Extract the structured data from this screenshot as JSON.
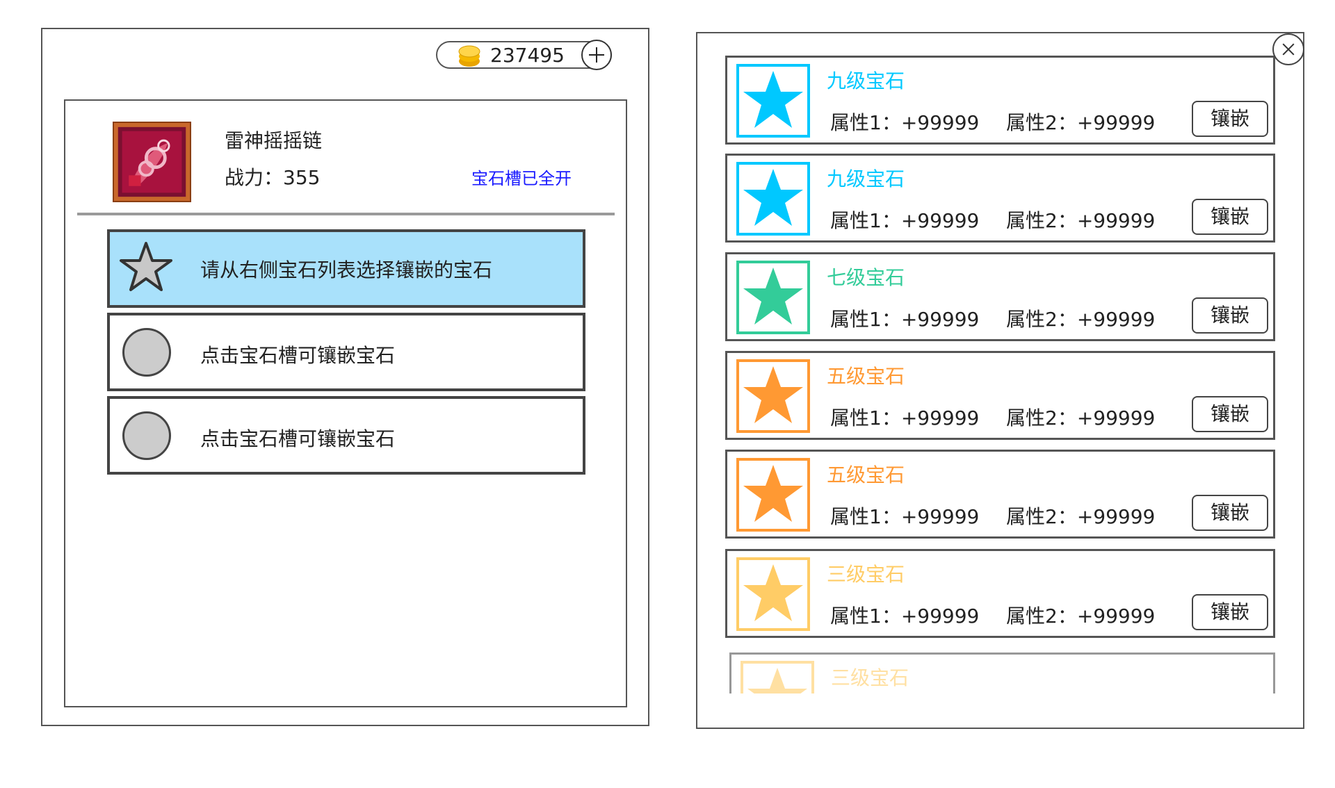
{
  "currency": {
    "amount": "237495",
    "icon": "coin-icon",
    "add_icon": "plus-icon"
  },
  "item": {
    "name": "雷神摇摇链",
    "power_label": "战力：355",
    "slots_status": "宝石槽已全开"
  },
  "slots": [
    {
      "state": "selected",
      "icon": "star-icon",
      "text": "请从右侧宝石列表选择镶嵌的宝石"
    },
    {
      "state": "empty",
      "icon": "empty-slot-circle",
      "text": "点击宝石槽可镶嵌宝石"
    },
    {
      "state": "empty",
      "icon": "empty-slot-circle",
      "text": "点击宝石槽可镶嵌宝石"
    }
  ],
  "gem_list": {
    "close_icon": "close-icon",
    "items": [
      {
        "name": "九级宝石",
        "color": "#00c8ff",
        "attr1": "属性1：+99999",
        "attr2": "属性2：+99999",
        "button": "镶嵌"
      },
      {
        "name": "九级宝石",
        "color": "#00c8ff",
        "attr1": "属性1：+99999",
        "attr2": "属性2：+99999",
        "button": "镶嵌"
      },
      {
        "name": "七级宝石",
        "color": "#33cc99",
        "attr1": "属性1：+99999",
        "attr2": "属性2：+99999",
        "button": "镶嵌"
      },
      {
        "name": "五级宝石",
        "color": "#ff9933",
        "attr1": "属性1：+99999",
        "attr2": "属性2：+99999",
        "button": "镶嵌"
      },
      {
        "name": "五级宝石",
        "color": "#ff9933",
        "attr1": "属性1：+99999",
        "attr2": "属性2：+99999",
        "button": "镶嵌"
      },
      {
        "name": "三级宝石",
        "color": "#ffcc66",
        "attr1": "属性1：+99999",
        "attr2": "属性2：+99999",
        "button": "镶嵌"
      },
      {
        "name": "三级宝石",
        "color": "#ffcc66",
        "attr1": "",
        "attr2": "",
        "button": "",
        "partial": true
      }
    ]
  }
}
